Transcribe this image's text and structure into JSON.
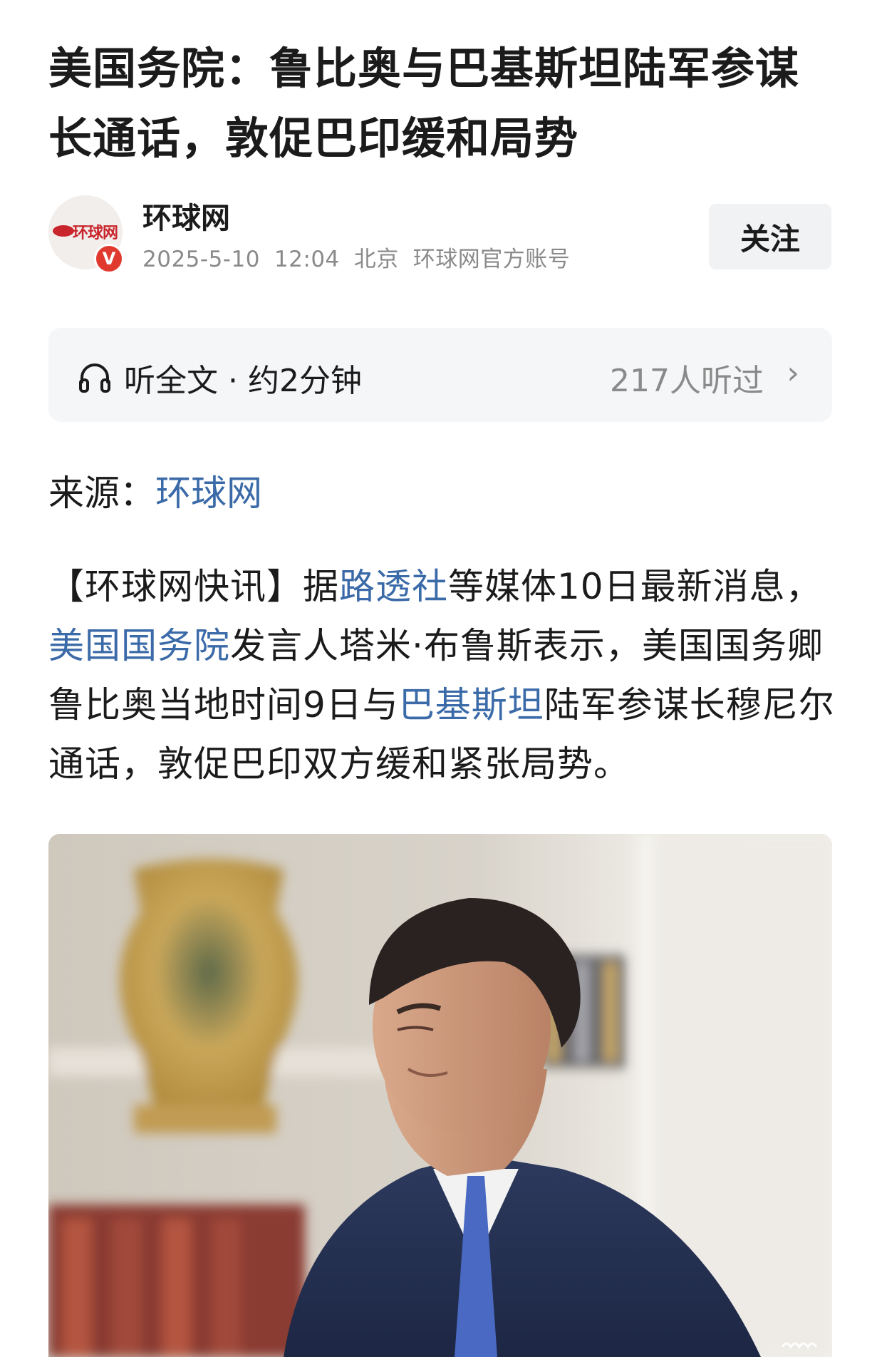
{
  "article": {
    "title": "美国务院：鲁比奥与巴基斯坦陆军参谋长通话，敦促巴印缓和局势"
  },
  "author": {
    "name": "环球网",
    "avatar_logo_text": "环球网",
    "verified_badge": "V",
    "date": "2025-5-10",
    "time": "12:04",
    "location": "北京",
    "account_type": "环球网官方账号",
    "follow_label": "关注"
  },
  "listen": {
    "icon": "headphones-icon",
    "label": "听全文 · 约2分钟",
    "count": "217人听过",
    "chevron": "›"
  },
  "source": {
    "label": "来源：",
    "name": "环球网"
  },
  "body": {
    "p1_a": "【环球网快讯】据",
    "p1_link1": "路透社",
    "p1_b": "等媒体10日最新消息，",
    "p1_link2": "美国国务院",
    "p1_c": "发言人塔米·布鲁斯表示，美国国务卿鲁比奥当地时间9日与",
    "p1_link3": "巴基斯坦",
    "p1_d": "陆军参谋长穆尼尔通话，敦促巴印双方缓和紧张局势。"
  },
  "colors": {
    "link": "#3b6aa8",
    "badge": "#e03a2f",
    "brand_red": "#c9252c",
    "meta_gray": "#8a8a8a"
  }
}
